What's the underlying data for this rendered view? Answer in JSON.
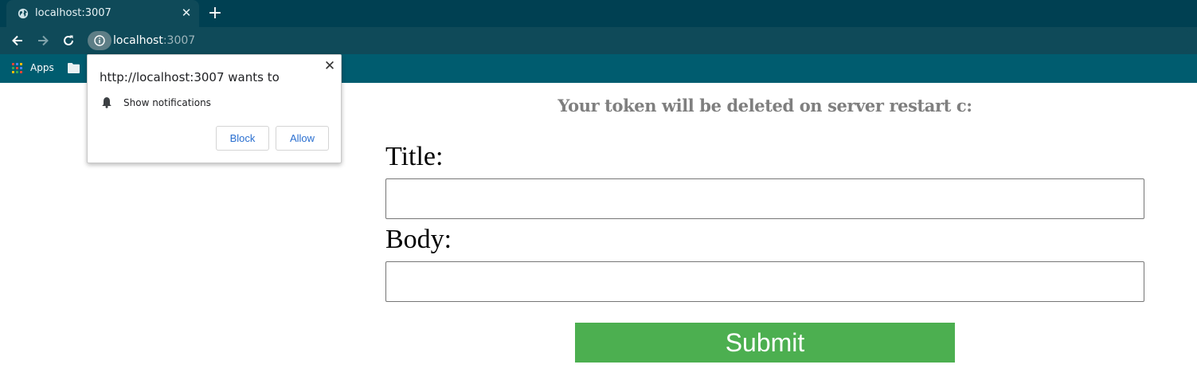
{
  "browser": {
    "tab_title": "localhost:3007",
    "url_host": "localhost",
    "url_port": ":3007",
    "bookmarks_apps_label": "Apps",
    "theme_colors": {
      "tabstrip": "#004052",
      "toolbar": "#0f4a59",
      "bookmarks_bar": "#005c6f"
    }
  },
  "permission_popup": {
    "title": "http://localhost:3007 wants to",
    "permission": "Show notifications",
    "block_label": "Block",
    "allow_label": "Allow"
  },
  "page": {
    "notice": "Your token will be deleted on server restart c:",
    "title_label": "Title:",
    "title_value": "",
    "body_label": "Body:",
    "body_value": "",
    "submit_label": "Submit",
    "submit_color": "#4caf50"
  },
  "icons": [
    "globe-icon",
    "close-icon",
    "plus-icon",
    "back-icon",
    "forward-icon",
    "reload-icon",
    "info-icon",
    "apps-grid-icon",
    "folder-icon",
    "bell-icon"
  ]
}
